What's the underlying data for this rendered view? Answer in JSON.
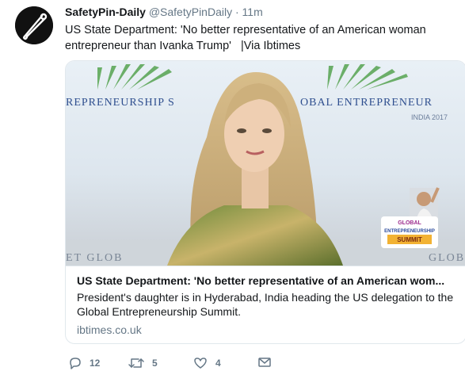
{
  "tweet": {
    "display_name": "SafetyPin-Daily",
    "handle": "@SafetyPinDaily",
    "separator": "·",
    "time": "11m",
    "text": "US State Department: 'No better representative of an American woman entrepreneur than Ivanka Trump'   |Via Ibtimes"
  },
  "card": {
    "image": {
      "banner_left": "REPRENEURSHIP S",
      "banner_right": "OBAL ENTREPRENEUR",
      "banner_sub": "INDIA 2017",
      "bottom_left": "ET  GLOB",
      "bottom_right": "GLOB",
      "logo_line1": "GLOBAL",
      "logo_line2": "ENTREPRENEURSHIP",
      "logo_line3": "SUMMIT"
    },
    "title": "US State Department: 'No better representative of an American wom...",
    "description": "President's daughter is in Hyderabad, India heading the US delegation to the Global Entrepreneurship Summit.",
    "domain": "ibtimes.co.uk"
  },
  "actions": {
    "reply_count": "12",
    "retweet_count": "5",
    "like_count": "4"
  },
  "icons": {
    "avatar": "safety-pin-logo",
    "reply": "reply-icon",
    "retweet": "retweet-icon",
    "like": "heart-icon",
    "message": "direct-message-icon"
  }
}
